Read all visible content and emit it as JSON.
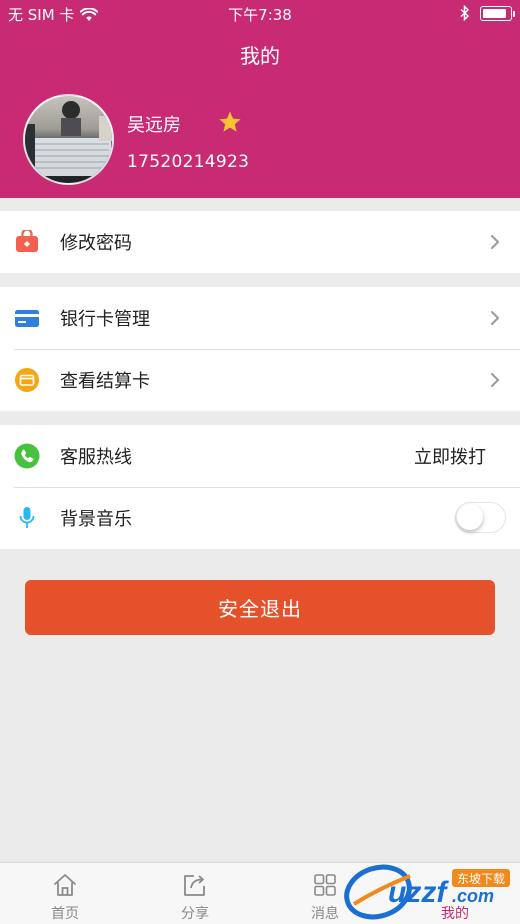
{
  "status_bar": {
    "carrier": "无 SIM 卡",
    "time": "下午7:38",
    "battery_level": 0.9
  },
  "header": {
    "title": "我的",
    "user_name": "吴远房",
    "phone": "17520214923"
  },
  "groups": [
    {
      "rows": [
        {
          "icon": "lock-briefcase-icon",
          "label": "修改密码",
          "accessory": "chevron"
        }
      ]
    },
    {
      "rows": [
        {
          "icon": "bank-card-icon",
          "label": "银行卡管理",
          "accessory": "chevron"
        },
        {
          "icon": "wallet-card-icon",
          "label": "查看结算卡",
          "accessory": "chevron"
        }
      ]
    },
    {
      "rows": [
        {
          "icon": "phone-icon",
          "label": "客服热线",
          "value": "立即拨打"
        },
        {
          "icon": "microphone-icon",
          "label": "背景音乐",
          "toggle_on": false
        }
      ]
    }
  ],
  "logout_label": "安全退出",
  "tabs": [
    {
      "label": "首页",
      "icon": "home-icon",
      "active": false
    },
    {
      "label": "分享",
      "icon": "share-icon",
      "active": false
    },
    {
      "label": "消息",
      "icon": "message-grid-icon",
      "active": false
    },
    {
      "label": "我的",
      "icon": "profile-icon",
      "active": true
    }
  ],
  "watermark": {
    "text": "uzzf.com",
    "subtext": "东坡下载"
  },
  "colors": {
    "brand": "#c82b74",
    "logout": "#e4512b",
    "background": "#ebebeb"
  }
}
